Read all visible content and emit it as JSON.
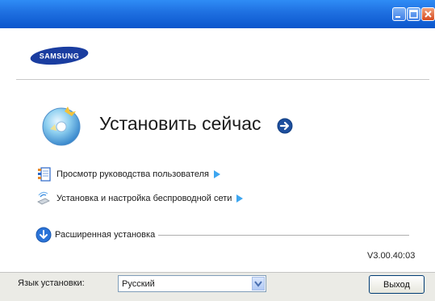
{
  "window": {
    "controls": {
      "minimize_icon": "minimize-icon",
      "maximize_icon": "maximize-icon",
      "close_icon": "close-icon"
    }
  },
  "brand": {
    "logo_text": "SAMSUNG",
    "logo_color": "#1a3da0"
  },
  "main": {
    "install_now": {
      "label": "Установить сейчас",
      "icon": "cd-icon",
      "arrow_icon": "arrow-right-circle-icon"
    },
    "links": [
      {
        "label": "Просмотр руководства пользователя",
        "icon": "manual-icon"
      },
      {
        "label": "Установка и настройка беспроводной сети",
        "icon": "wireless-icon"
      }
    ],
    "advanced": {
      "label": "Расширенная установка",
      "icon": "arrow-down-circle-icon"
    },
    "version": "V3.00.40:03"
  },
  "footer": {
    "language_label": "Язык установки:",
    "language_value": "Русский",
    "exit_label": "Выход"
  },
  "colors": {
    "titlebar": "#1e6fe0",
    "accent": "#2b74d8",
    "footer_bg": "#ebebe6"
  }
}
